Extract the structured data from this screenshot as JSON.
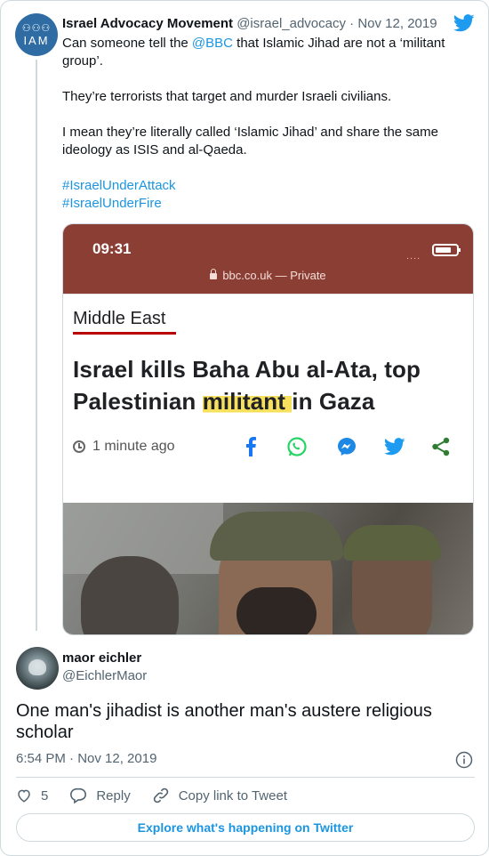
{
  "parent_tweet": {
    "author_name": "Israel Advocacy Movement",
    "handle": "@israel_advocacy",
    "separator": "·",
    "date": "Nov 12, 2019",
    "avatar": {
      "logo_figures": "⚇⚇⚇",
      "logo_text": "IAM"
    },
    "text": {
      "line1_prefix": "Can someone tell the ",
      "line1_mention": "@BBC",
      "line1_suffix": " that Islamic Jihad are not a ‘militant group’.",
      "para2": "They’re terrorists that target and murder Israeli civilians.",
      "para3": "I mean they’re literally called ‘Islamic Jihad’ and share the same ideology as ISIS and al-Qaeda.",
      "hashtag1": "#IsraelUnderAttack",
      "hashtag2": "#IsraelUnderFire"
    },
    "media": {
      "phone_time": "09:31",
      "signal_dots": "....",
      "url": "bbc.co.uk — Private",
      "section": "Middle East",
      "headline_before": "Israel kills Baha Abu al-Ata, top Palestinian ",
      "headline_highlight": "militant ",
      "headline_after": "in Gaza",
      "timestamp": "1 minute ago",
      "share_icons": [
        "facebook-icon",
        "whatsapp-icon",
        "messenger-icon",
        "twitter-icon",
        "share-icon"
      ]
    }
  },
  "reply_tweet": {
    "author_name": "maor eichler",
    "handle": "@EichlerMaor",
    "text": "One man's jihadist is another man's austere religious scholar",
    "time": "6:54 PM · Nov 12, 2019",
    "likes": "5",
    "reply_label": "Reply",
    "copy_link_label": "Copy link to Tweet"
  },
  "explore_label": "Explore what's happening on Twitter",
  "colors": {
    "link": "#1b95e0",
    "twitter_blue": "#1d9bf0",
    "bbc_header": "#8b3e34",
    "highlight": "#f6e05e",
    "bbc_red": "#b80000"
  }
}
